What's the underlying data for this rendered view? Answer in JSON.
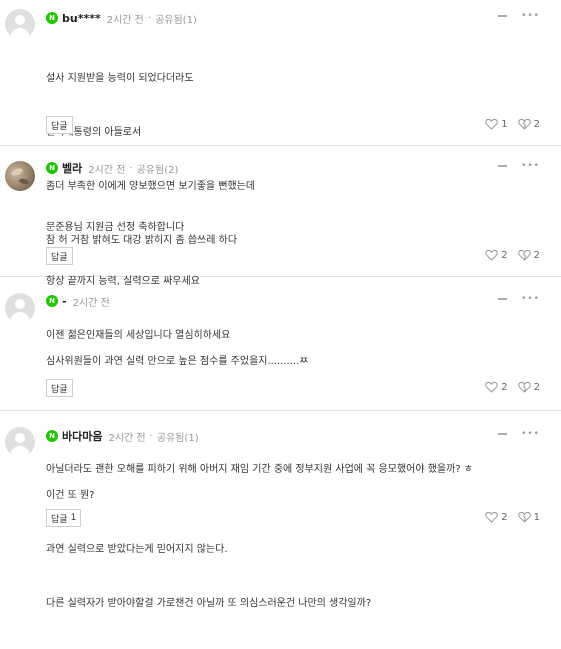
{
  "comments": [
    {
      "nickname": "bu****",
      "time": "2시간 전",
      "dot": "·",
      "share": "공유됨(1)",
      "body_lines": [
        "설사 지원받을 능력이 되었다더라도",
        "현직대통령의 아들로서",
        "좀더 부족한 이에게 양보했으면 보기좋을 뻔했는데",
        "참 허 거참 밝혀도 대강 밝히지 좀 씁쓰레 하다"
      ],
      "reply_label": "답글",
      "reply_count": "",
      "likes": "1",
      "dislikes": "2",
      "avatar": "default"
    },
    {
      "nickname": "벨라",
      "time": "2시간 전",
      "dot": "·",
      "share": "공유됨(2)",
      "body_lines": [
        "문준용님 지원금 선정 축하합니다",
        "항상 끝까지 능력, 실력으로 싸우세요",
        "이젠 젊은인재들의 세상입니다 열심히하세요"
      ],
      "reply_label": "답글",
      "reply_count": "",
      "likes": "2",
      "dislikes": "2",
      "avatar": "photo"
    },
    {
      "nickname": "-",
      "time": "2시간 전",
      "dot": "",
      "share": "",
      "body_lines": [
        "심사위원들이 과연 실력 만으로 높은 점수를 주었을지..........ㅉ",
        "",
        "아닐더라도 괜한 오해를 피하기 위해 아버지 재임 기간 중에 정부지원 사업에 꼭 응모했어야 했을까? ㅎ"
      ],
      "reply_label": "답글",
      "reply_count": "",
      "likes": "2",
      "dislikes": "2",
      "avatar": "default"
    },
    {
      "nickname": "바다마음",
      "time": "2시간 전",
      "dot": "·",
      "share": "공유됨(1)",
      "body_lines": [
        "이건 또 뭔?",
        "과연 실력으로 받았다는게 믿어지지 않는다.",
        "다른 실력자가 받아야할걸 가로챈건 아닐까 또 의심스러운건 나만의 생각일까?"
      ],
      "reply_label": "답글",
      "reply_count": "1",
      "likes": "2",
      "dislikes": "1",
      "avatar": "default"
    }
  ],
  "badge_letter": "N",
  "more_glyph": "•••",
  "colors": {
    "badge": "#1ec800",
    "text": "#333333",
    "meta": "#999999",
    "divider": "#e4e4e4"
  },
  "icons": {
    "like": "heart-outline-icon",
    "dislike": "broken-heart-outline-icon",
    "delete": "minus-icon",
    "more": "more-dots-icon"
  }
}
